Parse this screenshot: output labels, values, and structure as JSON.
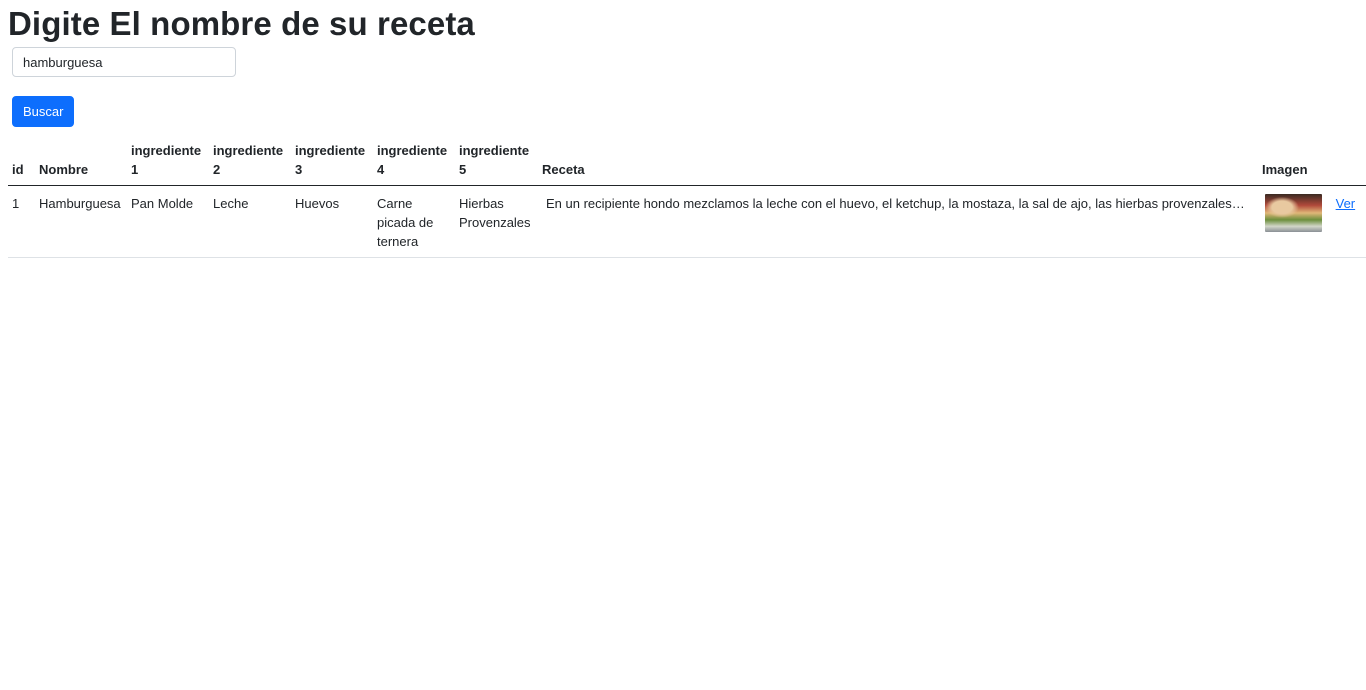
{
  "page": {
    "title": "Digite El nombre de su receta"
  },
  "search": {
    "value": "hamburguesa",
    "button_label": "Buscar"
  },
  "table": {
    "headers": {
      "id": "id",
      "nombre": "Nombre",
      "ing1": "ingrediente 1",
      "ing2": "ingrediente 2",
      "ing3": "ingrediente 3",
      "ing4": "ingrediente 4",
      "ing5": "ingrediente 5",
      "receta": "Receta",
      "imagen": "Imagen"
    },
    "rows": [
      {
        "id": "1",
        "nombre": "Hamburguesa",
        "ing1": "Pan Molde",
        "ing2": "Leche",
        "ing3": "Huevos",
        "ing4": "Carne picada de ternera",
        "ing5": "Hierbas Provenzales",
        "receta": "En un recipiente hondo mezclamos la leche con el huevo, el ketchup, la mostaza, la sal de ajo, las hierbas provenzales y sal...",
        "imagen_icon": "burger-photo",
        "link": "Ver"
      }
    ]
  }
}
